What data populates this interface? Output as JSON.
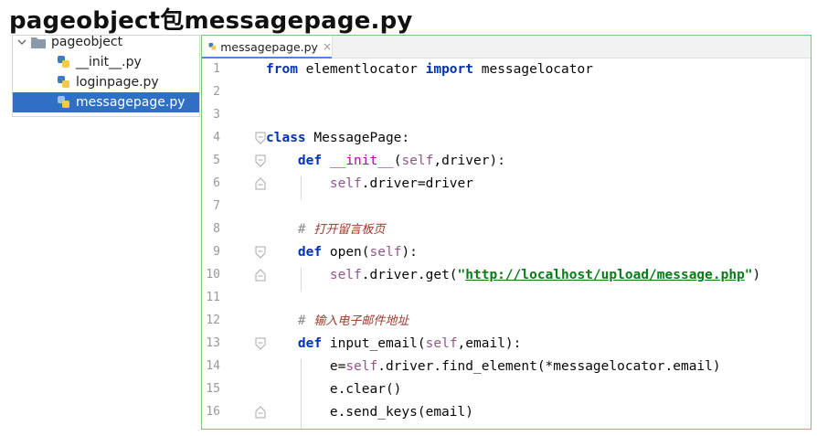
{
  "heading": "pageobject包messagepage.py",
  "project_tree": {
    "folder": "pageobject",
    "files": [
      "__init__.py",
      "loginpage.py",
      "messagepage.py"
    ],
    "selected_index": 2
  },
  "editor": {
    "tab_label": "messagepage.py",
    "tab_close": "×",
    "line_numbers": [
      "1",
      "2",
      "3",
      "4",
      "5",
      "6",
      "7",
      "8",
      "9",
      "10",
      "11",
      "12",
      "13",
      "14",
      "15",
      "16"
    ],
    "code": {
      "l1_a": "from",
      "l1_b": " elementlocator ",
      "l1_c": "import",
      "l1_d": " messagelocator",
      "l4_a": "class",
      "l4_b": " MessagePage:",
      "l5_indent": "    ",
      "l5_a": "def",
      "l5_b": " ",
      "l5_c": "__init__",
      "l5_d": "(",
      "l5_e": "self",
      "l5_f": ",driver):",
      "l6_indent": "        ",
      "l6_a": "self",
      "l6_b": ".driver=driver",
      "l8_indent": "    ",
      "l8_a": "# ",
      "l8_b": "打开留言板页",
      "l9_indent": "    ",
      "l9_a": "def",
      "l9_b": " ",
      "l9_c": "open",
      "l9_d": "(",
      "l9_e": "self",
      "l9_f": "):",
      "l10_indent": "        ",
      "l10_a": "self",
      "l10_b": ".driver.get(",
      "l10_c": "\"",
      "l10_d": "http://localhost/upload/message.php",
      "l10_e": "\"",
      "l10_f": ")",
      "l12_indent": "    ",
      "l12_a": "# ",
      "l12_b": "输入电子邮件地址",
      "l13_indent": "    ",
      "l13_a": "def",
      "l13_b": " ",
      "l13_c": "input_email",
      "l13_d": "(",
      "l13_e": "self",
      "l13_f": ",email):",
      "l14_indent": "        ",
      "l14_a": "e=",
      "l14_b": "self",
      "l14_c": ".driver.find_element(*messagelocator.email)",
      "l15_indent": "        ",
      "l15_a": "e.clear()",
      "l16_indent": "        ",
      "l16_a": "e.send_keys(email)"
    }
  }
}
